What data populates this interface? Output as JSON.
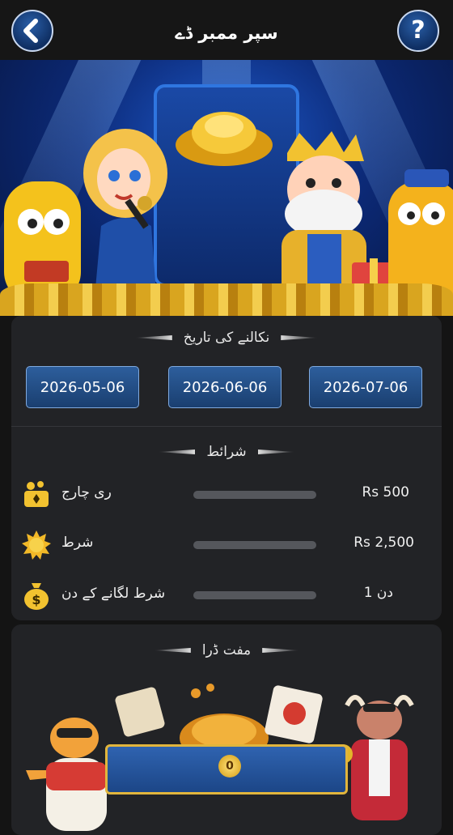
{
  "header": {
    "title": "سپر ممبر ڈے",
    "back_icon": "chevron-left-icon",
    "help_label": "?"
  },
  "colors": {
    "accent_blue": "#1f4f8f",
    "gold": "#e3b62a",
    "panel_bg": "#222326",
    "page_bg": "#141414"
  },
  "draw_dates": {
    "heading": "نکالنے کی تاریخ",
    "dates": [
      "2026-05-06",
      "2026-06-06",
      "2026-07-06"
    ]
  },
  "conditions": {
    "heading": "شرائط",
    "items": [
      {
        "icon": "recharge-gift-icon",
        "label": "ری چارج",
        "value": "Rs 500",
        "progress": 0
      },
      {
        "icon": "coin-burst-icon",
        "label": "شرط",
        "value": "Rs 2,500",
        "progress": 0
      },
      {
        "icon": "money-bag-icon",
        "label": "شرط لگانے کے دن",
        "value": "دن 1",
        "progress": 0
      }
    ]
  },
  "free_draw": {
    "heading": "مفت ڈرا",
    "count": "0"
  }
}
